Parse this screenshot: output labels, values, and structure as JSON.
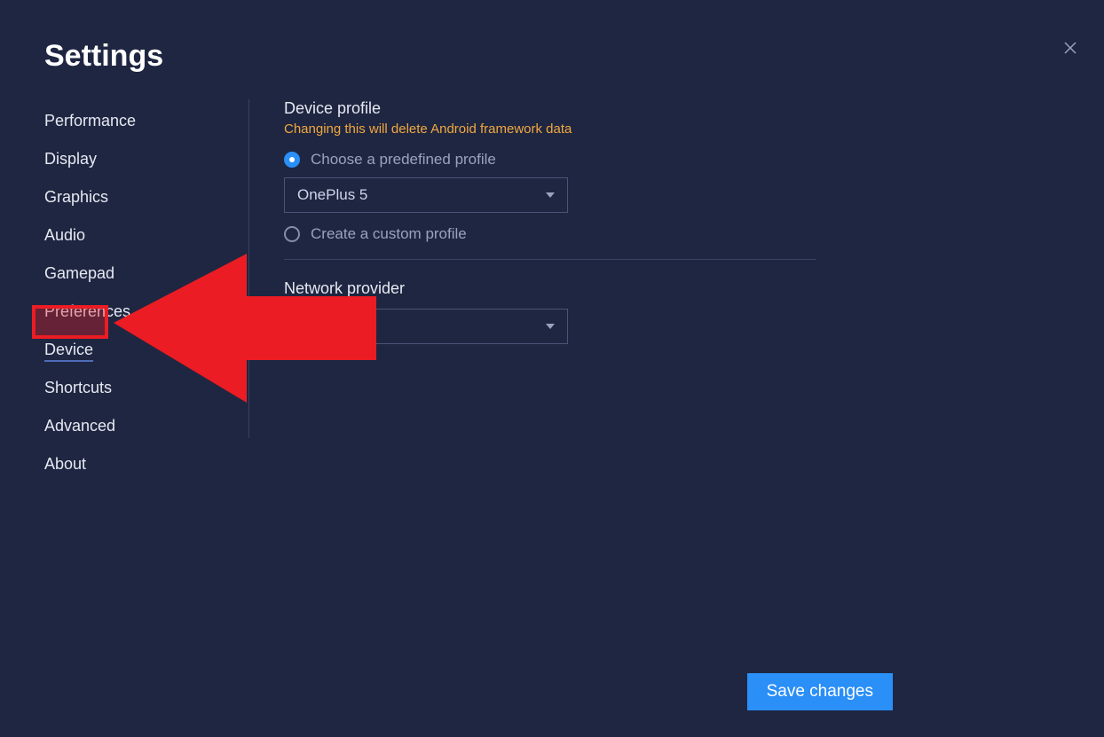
{
  "header": {
    "title": "Settings"
  },
  "sidebar": {
    "items": [
      {
        "label": "Performance"
      },
      {
        "label": "Display"
      },
      {
        "label": "Graphics"
      },
      {
        "label": "Audio"
      },
      {
        "label": "Gamepad"
      },
      {
        "label": "Preferences"
      },
      {
        "label": "Device"
      },
      {
        "label": "Shortcuts"
      },
      {
        "label": "Advanced"
      },
      {
        "label": "About"
      }
    ],
    "active_index": 6
  },
  "device": {
    "profile_section_title": "Device profile",
    "profile_warning": "Changing this will delete Android framework data",
    "radio_predefined_label": "Choose a predefined profile",
    "radio_custom_label": "Create a custom profile",
    "selected_radio": "predefined",
    "predefined_profile_value": "OnePlus 5",
    "network_section_title": "Network provider",
    "network_value": ""
  },
  "buttons": {
    "save_label": "Save changes"
  },
  "annotation": {
    "arrow_target": "Device"
  }
}
